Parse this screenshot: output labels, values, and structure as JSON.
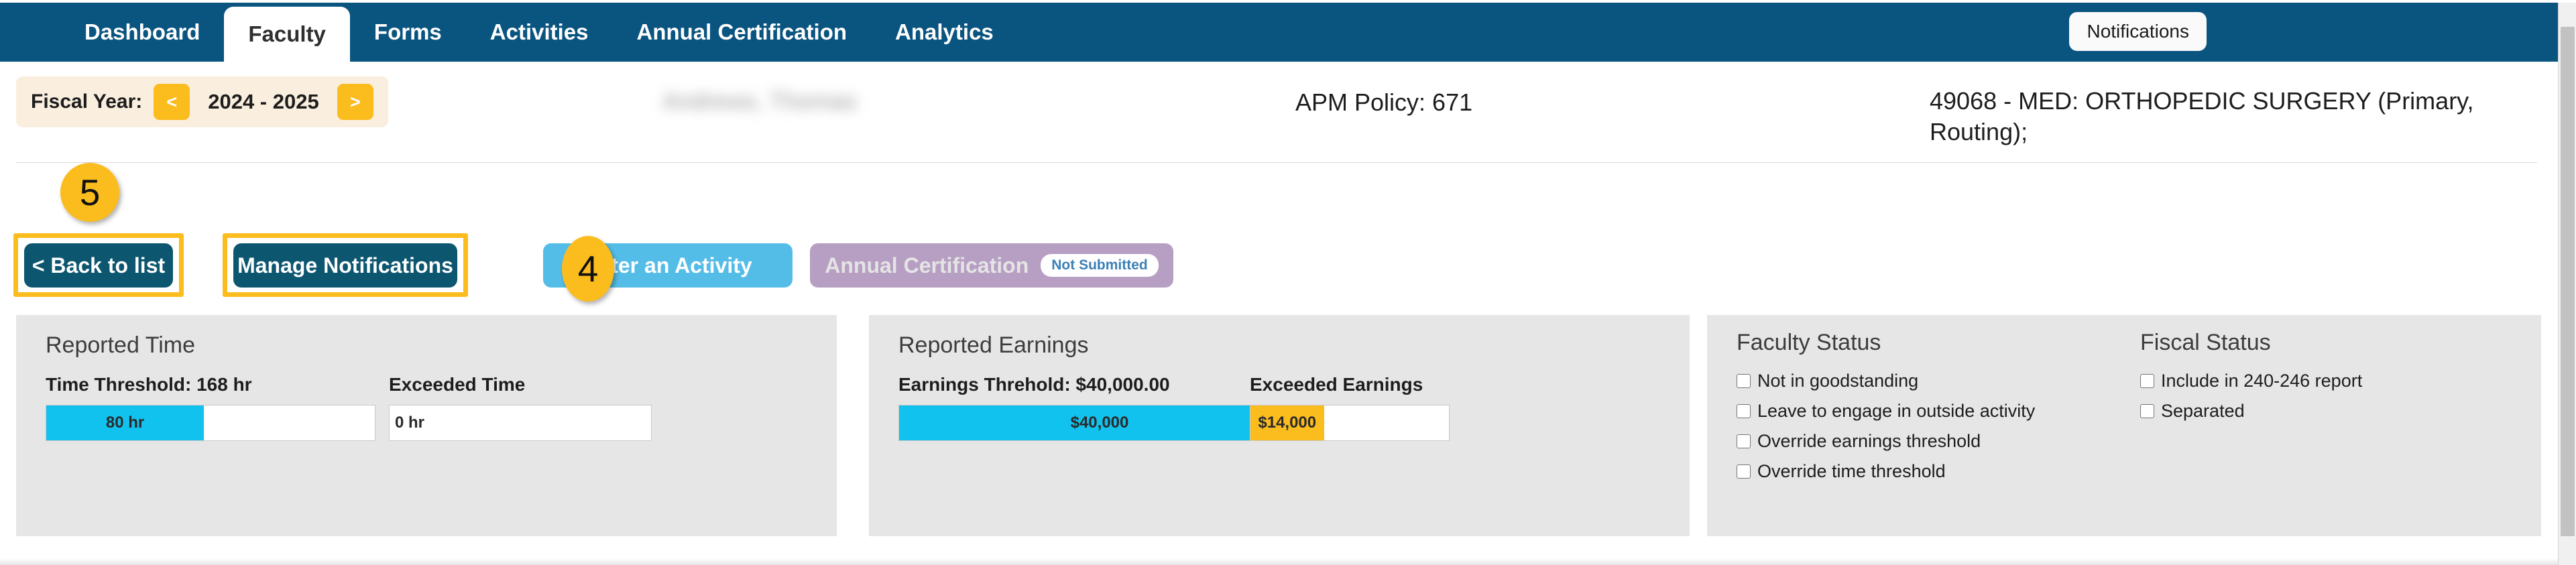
{
  "nav": {
    "tabs": [
      {
        "label": "Dashboard",
        "active": false
      },
      {
        "label": "Faculty",
        "active": true
      },
      {
        "label": "Forms",
        "active": false
      },
      {
        "label": "Activities",
        "active": false
      },
      {
        "label": "Annual Certification",
        "active": false
      },
      {
        "label": "Analytics",
        "active": false
      }
    ],
    "notifications_label": "Notifications",
    "bar_color": "#0a5480"
  },
  "header": {
    "fiscal_year_label": "Fiscal Year:",
    "fiscal_year_prev": "<",
    "fiscal_year_value": "2024 - 2025",
    "fiscal_year_next": ">",
    "person_name": "Andrews, Thomas",
    "apm_policy": "APM Policy: 671",
    "department": "49068 - MED: ORTHOPEDIC SURGERY (Primary, Routing);"
  },
  "annotations": [
    {
      "number": "5",
      "target": "fiscal-year-selector"
    },
    {
      "number": "4",
      "target": "enter-an-activity-button"
    }
  ],
  "actions": {
    "back_to_list": "< Back to list",
    "manage_notifications": "Manage Notifications",
    "enter_activity": "Enter an Activity",
    "annual_certification": "Annual Certification",
    "annual_certification_status": "Not Submitted"
  },
  "reported_time": {
    "title": "Reported Time",
    "threshold_label": "Time Threshold: 168 hr",
    "exceeded_label": "Exceeded Time",
    "used_value": "80 hr",
    "exceeded_value": "0 hr"
  },
  "reported_earnings": {
    "title": "Reported Earnings",
    "threshold_label": "Earnings Threhold: $40,000.00",
    "exceeded_label": "Exceeded Earnings",
    "used_value": "$40,000",
    "exceeded_value": "$14,000"
  },
  "faculty_status": {
    "title": "Faculty Status",
    "items": [
      {
        "label": "Not in goodstanding",
        "checked": false
      },
      {
        "label": "Leave to engage in outside activity",
        "checked": false
      },
      {
        "label": "Override earnings threshold",
        "checked": false
      },
      {
        "label": "Override time threshold",
        "checked": false
      }
    ]
  },
  "fiscal_status": {
    "title": "Fiscal Status",
    "items": [
      {
        "label": "Include in 240-246 report",
        "checked": false
      },
      {
        "label": "Separated",
        "checked": false
      }
    ]
  },
  "colors": {
    "nav_blue": "#0a5480",
    "button_teal": "#0d5670",
    "activity_blue": "#54bde7",
    "certification_purple": "#b79fc4",
    "highlight_yellow": "#fbbc1e",
    "progress_cyan": "#12c2ee",
    "panel_gray": "#e6e6e6"
  }
}
